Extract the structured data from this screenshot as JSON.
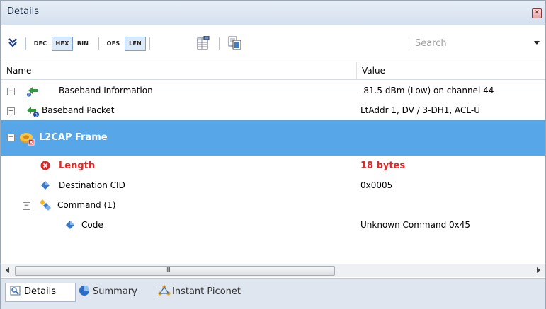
{
  "window": {
    "title": "Details",
    "close_label": "✕"
  },
  "toolbar": {
    "buttons": [
      {
        "label": "DEC",
        "active": false
      },
      {
        "label": "HEX",
        "active": true
      },
      {
        "label": "BIN",
        "active": false
      },
      {
        "label": "OFS",
        "active": false
      },
      {
        "label": "LEN",
        "active": true
      }
    ],
    "expand_icon": "double-chevron-down-icon",
    "search_placeholder": "Search"
  },
  "columns": {
    "name": "Name",
    "value": "Value"
  },
  "rows": [
    {
      "name": "Baseband Information",
      "value": "-81.5 dBm (Low) on channel 44",
      "expander": "⊞",
      "icon": "baseband-info-icon"
    },
    {
      "name": "Baseband Packet",
      "value": "LtAddr 1, DV / 3-DH1, ACL-U",
      "expander": "⊞",
      "icon": "baseband-packet-icon"
    },
    {
      "name": "L2CAP Frame",
      "value": "",
      "expander": "⊟",
      "icon": "l2cap-error-icon",
      "selected": true
    },
    {
      "name": "Length",
      "value": "18 bytes",
      "icon": "error-icon",
      "error": true
    },
    {
      "name": "Destination CID",
      "value": "0x0005",
      "icon": "diamond-icon"
    },
    {
      "name": "Command (1)",
      "value": "",
      "expander": "⊟",
      "icon": "command-icon"
    },
    {
      "name": "Code",
      "value": "Unknown Command 0x45",
      "icon": "diamond-icon"
    }
  ],
  "scrollbar": {
    "grip": "III"
  },
  "tabs": [
    {
      "label": "Details",
      "active": true,
      "icon": "details-icon"
    },
    {
      "label": "Summary",
      "active": false,
      "icon": "summary-icon"
    },
    {
      "label": "Instant Piconet",
      "active": false,
      "icon": "piconet-icon"
    }
  ],
  "colors": {
    "selection": "#56a6e8",
    "error": "#e02828",
    "toolbar_active": "#dce9f8"
  }
}
